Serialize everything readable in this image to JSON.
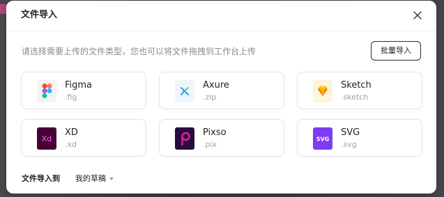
{
  "dialog": {
    "title": "文件导入",
    "hint": "请选择需要上传的文件类型，您也可以将文件拖拽到工作台上传",
    "batch_import_label": "批量导入",
    "file_types": [
      {
        "name": "Figma",
        "ext": ".fig",
        "icon": "figma-icon",
        "color": "#f24e1e"
      },
      {
        "name": "Axure",
        "ext": ".zip",
        "icon": "axure-icon",
        "color": "#1aa3d9"
      },
      {
        "name": "Sketch",
        "ext": ".sketch",
        "icon": "sketch-icon",
        "color": "#fdb300"
      },
      {
        "name": "XD",
        "ext": ".xd",
        "icon": "xd-icon",
        "color": "#ff61f6"
      },
      {
        "name": "Pixso",
        "ext": ".pix",
        "icon": "pixso-icon",
        "color": "#d21f97"
      },
      {
        "name": "SVG",
        "ext": ".svg",
        "icon": "svg-icon",
        "color": "#7d3cf0"
      }
    ],
    "import_to_label": "文件导入到",
    "import_to_value": "我的草稿"
  }
}
